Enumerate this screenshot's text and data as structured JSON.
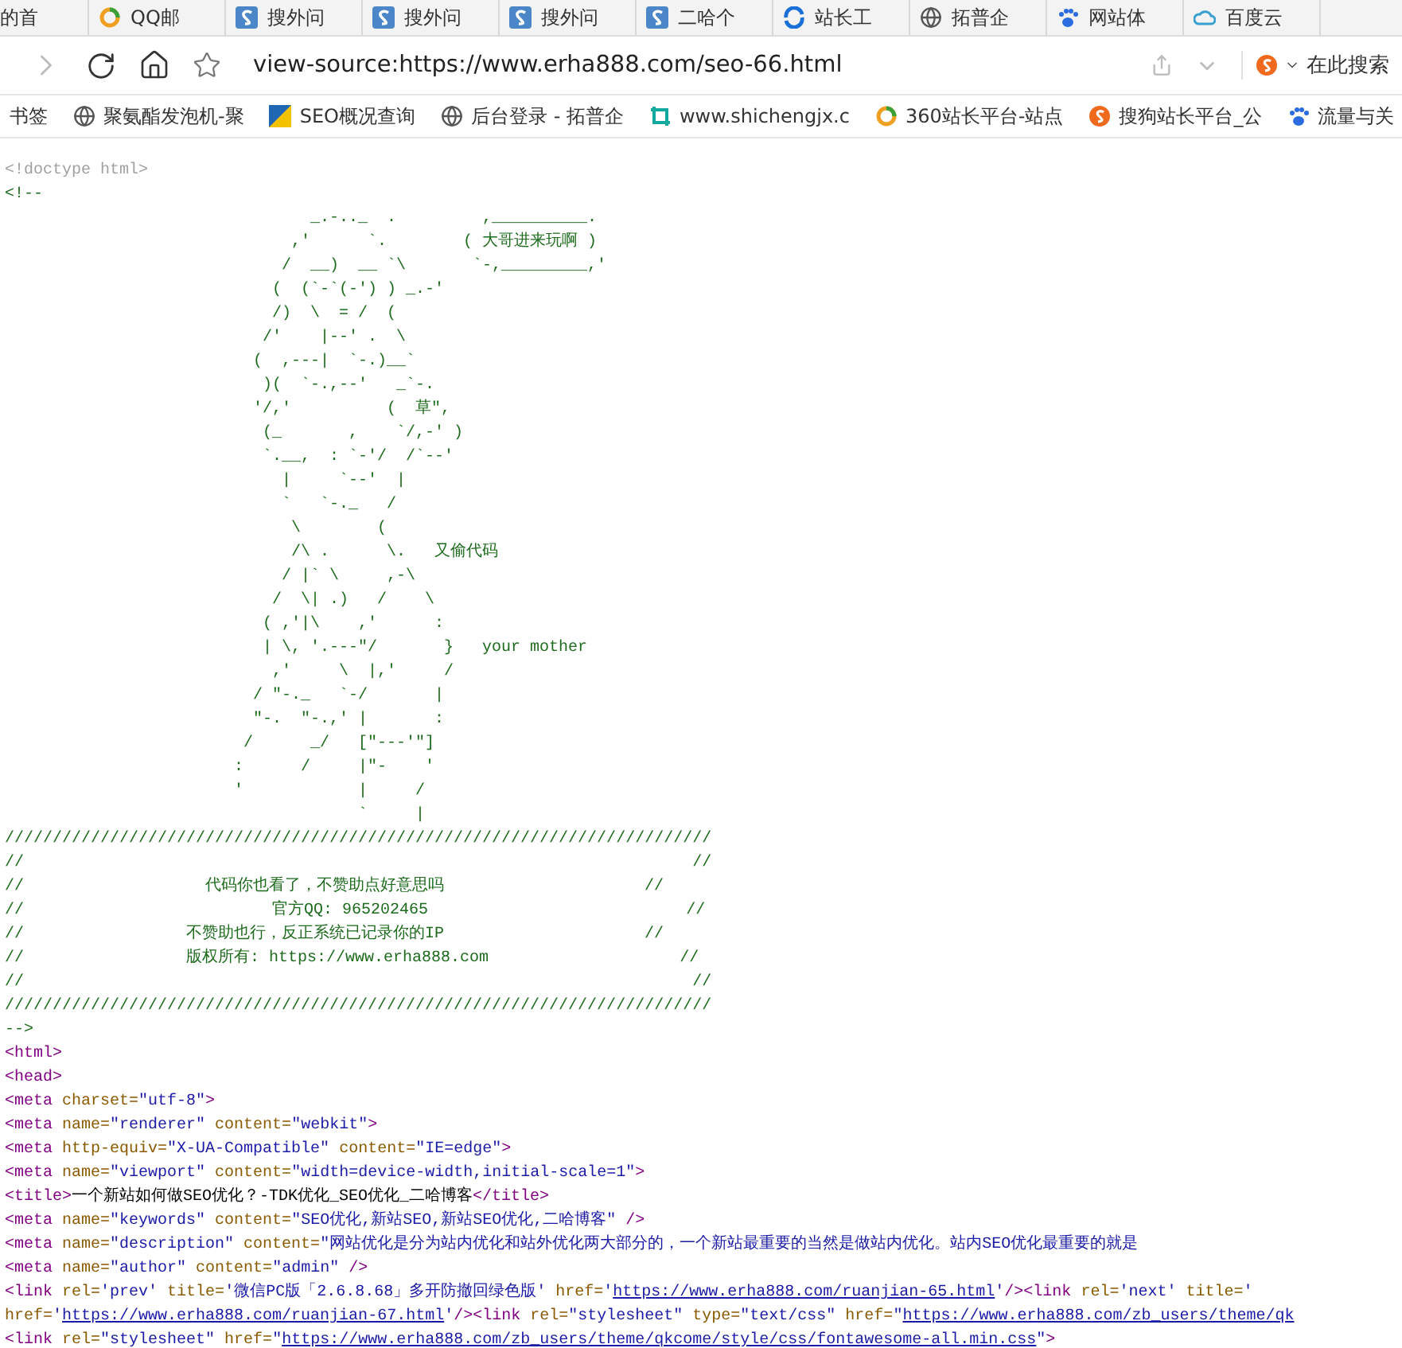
{
  "tabs": [
    {
      "label": "的首",
      "kind": "plain"
    },
    {
      "label": "QQ邮",
      "kind": "ring"
    },
    {
      "label": "搜外问",
      "kind": "tile"
    },
    {
      "label": "搜外问",
      "kind": "tile"
    },
    {
      "label": "搜外问",
      "kind": "tile"
    },
    {
      "label": "二哈个",
      "kind": "tile"
    },
    {
      "label": "站长工",
      "kind": "swirl"
    },
    {
      "label": "拓普企",
      "kind": "globe"
    },
    {
      "label": "网站体",
      "kind": "paw"
    },
    {
      "label": "百度云",
      "kind": "cloud"
    }
  ],
  "address_bar": {
    "url": "view-source:https://www.erha888.com/seo-66.html",
    "search_placeholder": "在此搜索"
  },
  "bookmarks": [
    {
      "label": "书签",
      "kind": "plain"
    },
    {
      "label": "聚氨酯发泡机-聚",
      "kind": "globe"
    },
    {
      "label": "SEO概况查询",
      "kind": "flag"
    },
    {
      "label": "后台登录 - 拓普企",
      "kind": "globe"
    },
    {
      "label": "www.shichengjx.c",
      "kind": "crop"
    },
    {
      "label": "360站长平台-站点",
      "kind": "ring"
    },
    {
      "label": "搜狗站长平台_公",
      "kind": "sogou"
    },
    {
      "label": "流量与关",
      "kind": "paw"
    }
  ],
  "source": [
    [
      {
        "kind": "doctype",
        "text": "<!doctype html>"
      }
    ],
    [
      {
        "kind": "comment",
        "text": "<!--"
      }
    ],
    [
      {
        "kind": "comment",
        "text": "                                _.-.._  .         ,__________."
      }
    ],
    [
      {
        "kind": "comment",
        "text": "                              ,'      `.        ( 大哥进来玩啊 )"
      }
    ],
    [
      {
        "kind": "comment",
        "text": "                             /  __)  __ `\\       `-,_________,'"
      }
    ],
    [
      {
        "kind": "comment",
        "text": "                            (  (`-`(-') ) _.-'"
      }
    ],
    [
      {
        "kind": "comment",
        "text": "                            /)  \\  = /  ("
      }
    ],
    [
      {
        "kind": "comment",
        "text": "                           /'    |--' .  \\"
      }
    ],
    [
      {
        "kind": "comment",
        "text": "                          (  ,---|  `-.)__`"
      }
    ],
    [
      {
        "kind": "comment",
        "text": "                           )(  `-.,--'   _`-."
      }
    ],
    [
      {
        "kind": "comment",
        "text": "                          '/,'          (  草\","
      }
    ],
    [
      {
        "kind": "comment",
        "text": "                           (_       ,    `/,-' )"
      }
    ],
    [
      {
        "kind": "comment",
        "text": "                           `.__,  : `-'/  /`--'"
      }
    ],
    [
      {
        "kind": "comment",
        "text": "                             |     `--'  |"
      }
    ],
    [
      {
        "kind": "comment",
        "text": "                             `   `-._   /"
      }
    ],
    [
      {
        "kind": "comment",
        "text": "                              \\        ("
      }
    ],
    [
      {
        "kind": "comment",
        "text": "                              /\\ .      \\.   又偷代码"
      }
    ],
    [
      {
        "kind": "comment",
        "text": "                             / |` \\     ,-\\"
      }
    ],
    [
      {
        "kind": "comment",
        "text": "                            /  \\| .)   /    \\"
      }
    ],
    [
      {
        "kind": "comment",
        "text": "                           ( ,'|\\    ,'      :"
      }
    ],
    [
      {
        "kind": "comment",
        "text": "                           | \\, '.---\"/       }   your mother"
      }
    ],
    [
      {
        "kind": "comment",
        "text": "                            ,'     \\  |,'     /"
      }
    ],
    [
      {
        "kind": "comment",
        "text": "                          / \"-._   `-/       |"
      }
    ],
    [
      {
        "kind": "comment",
        "text": "                          \"-.  \"-.,' |       :"
      }
    ],
    [
      {
        "kind": "comment",
        "text": "                         /      _/   [\"---'\"]"
      }
    ],
    [
      {
        "kind": "comment",
        "text": "                        :      /     |\"-    '"
      }
    ],
    [
      {
        "kind": "comment",
        "text": "                        '            |     /"
      }
    ],
    [
      {
        "kind": "comment",
        "text": "                                     `     |"
      }
    ],
    [
      {
        "kind": "comment",
        "text": "//////////////////////////////////////////////////////////////////////////"
      }
    ],
    [
      {
        "kind": "comment",
        "text": "//                                                                      //"
      }
    ],
    [
      {
        "kind": "comment",
        "text": "//                   代码你也看了，不赞助点好意思吗                     //"
      }
    ],
    [
      {
        "kind": "comment",
        "text": "//                          官方QQ: 965202465                           //"
      }
    ],
    [
      {
        "kind": "comment",
        "text": "//                 不赞助也行，反正系统已记录你的IP                     //"
      }
    ],
    [
      {
        "kind": "comment",
        "text": "//                 版权所有: https://www.erha888.com                    //"
      }
    ],
    [
      {
        "kind": "comment",
        "text": "//                                                                      //"
      }
    ],
    [
      {
        "kind": "comment",
        "text": "//////////////////////////////////////////////////////////////////////////"
      }
    ],
    [
      {
        "kind": "comment",
        "text": "-->"
      }
    ],
    [
      {
        "kind": "tag",
        "text": "<html>"
      }
    ],
    [
      {
        "kind": "tag",
        "text": "<head>"
      }
    ],
    [
      {
        "kind": "tag",
        "text": "<meta "
      },
      {
        "kind": "attr",
        "text": "charset="
      },
      {
        "kind": "value",
        "text": "\"utf-8\""
      },
      {
        "kind": "tag",
        "text": ">"
      }
    ],
    [
      {
        "kind": "tag",
        "text": "<meta "
      },
      {
        "kind": "attr",
        "text": "name="
      },
      {
        "kind": "value",
        "text": "\"renderer\" "
      },
      {
        "kind": "attr",
        "text": "content="
      },
      {
        "kind": "value",
        "text": "\"webkit\""
      },
      {
        "kind": "tag",
        "text": ">"
      }
    ],
    [
      {
        "kind": "tag",
        "text": "<meta "
      },
      {
        "kind": "attr",
        "text": "http-equiv="
      },
      {
        "kind": "value",
        "text": "\"X-UA-Compatible\" "
      },
      {
        "kind": "attr",
        "text": "content="
      },
      {
        "kind": "value",
        "text": "\"IE=edge\""
      },
      {
        "kind": "tag",
        "text": ">"
      }
    ],
    [
      {
        "kind": "tag",
        "text": "<meta "
      },
      {
        "kind": "attr",
        "text": "name="
      },
      {
        "kind": "value",
        "text": "\"viewport\" "
      },
      {
        "kind": "attr",
        "text": "content="
      },
      {
        "kind": "value",
        "text": "\"width=device-width,initial-scale=1\""
      },
      {
        "kind": "tag",
        "text": ">"
      }
    ],
    [
      {
        "kind": "tag",
        "text": "<title>"
      },
      {
        "kind": "text",
        "text": "一个新站如何做SEO优化？-TDK优化_SEO优化_二哈博客"
      },
      {
        "kind": "tag",
        "text": "</title>"
      }
    ],
    [
      {
        "kind": "tag",
        "text": "<meta "
      },
      {
        "kind": "attr",
        "text": "name="
      },
      {
        "kind": "value",
        "text": "\"keywords\" "
      },
      {
        "kind": "attr",
        "text": "content="
      },
      {
        "kind": "value",
        "text": "\"SEO优化,新站SEO,新站SEO优化,二哈博客\" "
      },
      {
        "kind": "tag",
        "text": "/>"
      }
    ],
    [
      {
        "kind": "tag",
        "text": "<meta "
      },
      {
        "kind": "attr",
        "text": "name="
      },
      {
        "kind": "value",
        "text": "\"description\" "
      },
      {
        "kind": "attr",
        "text": "content="
      },
      {
        "kind": "value",
        "text": "\"网站优化是分为站内优化和站外优化两大部分的，一个新站最重要的当然是做站内优化。站内SEO优化最重要的就是"
      }
    ],
    [
      {
        "kind": "tag",
        "text": "<meta "
      },
      {
        "kind": "attr",
        "text": "name="
      },
      {
        "kind": "value",
        "text": "\"author\" "
      },
      {
        "kind": "attr",
        "text": "content="
      },
      {
        "kind": "value",
        "text": "\"admin\" "
      },
      {
        "kind": "tag",
        "text": "/>"
      }
    ],
    [
      {
        "kind": "tag",
        "text": "<link "
      },
      {
        "kind": "attr",
        "text": "rel="
      },
      {
        "kind": "value",
        "text": "'prev' "
      },
      {
        "kind": "attr",
        "text": "title="
      },
      {
        "kind": "value",
        "text": "'微信PC版「2.6.8.68」多开防撤回绿色版' "
      },
      {
        "kind": "attr",
        "text": "href="
      },
      {
        "kind": "value",
        "text": "'"
      },
      {
        "kind": "link",
        "text": "https://www.erha888.com/ruanjian-65.html"
      },
      {
        "kind": "value",
        "text": "'"
      },
      {
        "kind": "tag",
        "text": "/><link "
      },
      {
        "kind": "attr",
        "text": "rel="
      },
      {
        "kind": "value",
        "text": "'next' "
      },
      {
        "kind": "attr",
        "text": "title="
      },
      {
        "kind": "value",
        "text": "'"
      }
    ],
    [
      {
        "kind": "attr",
        "text": "href="
      },
      {
        "kind": "value",
        "text": "'"
      },
      {
        "kind": "link",
        "text": "https://www.erha888.com/ruanjian-67.html"
      },
      {
        "kind": "value",
        "text": "'"
      },
      {
        "kind": "tag",
        "text": "/><link "
      },
      {
        "kind": "attr",
        "text": "rel="
      },
      {
        "kind": "value",
        "text": "\"stylesheet\" "
      },
      {
        "kind": "attr",
        "text": "type="
      },
      {
        "kind": "value",
        "text": "\"text/css\" "
      },
      {
        "kind": "attr",
        "text": "href="
      },
      {
        "kind": "value",
        "text": "\""
      },
      {
        "kind": "link",
        "text": "https://www.erha888.com/zb_users/theme/qk"
      }
    ],
    [
      {
        "kind": "tag",
        "text": "<link "
      },
      {
        "kind": "attr",
        "text": "rel="
      },
      {
        "kind": "value",
        "text": "\"stylesheet\" "
      },
      {
        "kind": "attr",
        "text": "href="
      },
      {
        "kind": "value",
        "text": "\""
      },
      {
        "kind": "link",
        "text": "https://www.erha888.com/zb_users/theme/qkcome/style/css/fontawesome-all.min.css"
      },
      {
        "kind": "value",
        "text": "\""
      },
      {
        "kind": "tag",
        "text": ">"
      }
    ]
  ]
}
